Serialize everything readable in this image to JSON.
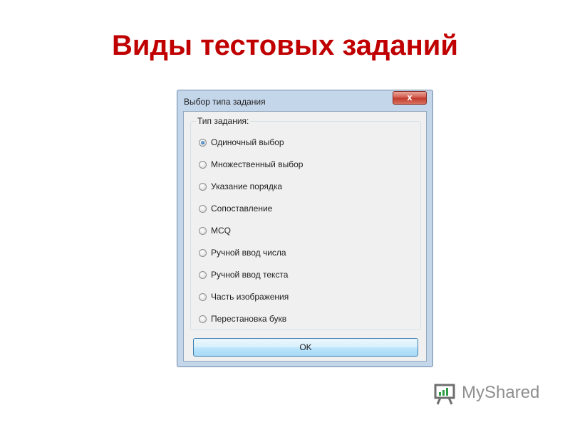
{
  "slide": {
    "title": "Виды тестовых заданий"
  },
  "dialog": {
    "title": "Выбор типа задания",
    "close_label": "x",
    "group_label": "Тип задания:",
    "options": [
      {
        "label": "Одиночный выбор",
        "selected": true
      },
      {
        "label": "Множественный выбор",
        "selected": false
      },
      {
        "label": "Указание порядка",
        "selected": false
      },
      {
        "label": "Сопоставление",
        "selected": false
      },
      {
        "label": "MCQ",
        "selected": false
      },
      {
        "label": "Ручной ввод числа",
        "selected": false
      },
      {
        "label": "Ручной ввод текста",
        "selected": false
      },
      {
        "label": "Часть изображения",
        "selected": false
      },
      {
        "label": "Перестановка букв",
        "selected": false
      }
    ],
    "ok_label": "OK"
  },
  "watermark": {
    "text": "MyShared",
    "icon": "presentation-board-icon"
  },
  "colors": {
    "title": "#c00000",
    "dialog_frame": "#c4d6ea",
    "close_button": "#c0392b",
    "radio_dot": "#1e5d9b"
  }
}
